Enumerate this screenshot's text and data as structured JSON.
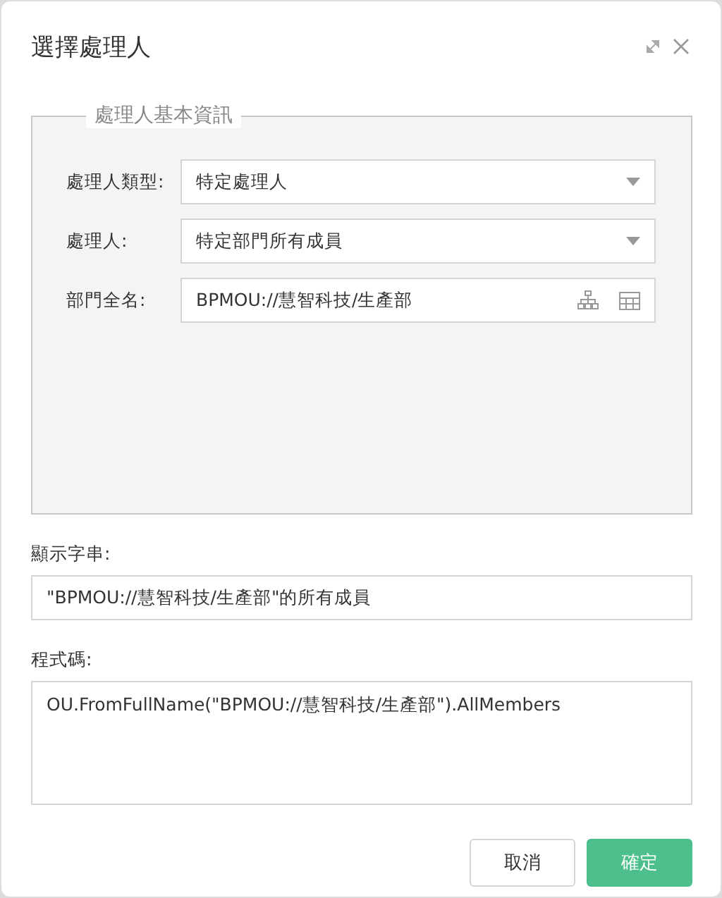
{
  "window": {
    "title": "選擇處理人"
  },
  "basic_info": {
    "legend": "處理人基本資訊",
    "rows": [
      {
        "kind": "select",
        "label": "處理人類型:",
        "value": "特定處理人"
      },
      {
        "kind": "select",
        "label": "處理人:",
        "value": "特定部門所有成員"
      },
      {
        "kind": "picker",
        "label": "部門全名:",
        "value": "BPMOU://慧智科技/生產部"
      }
    ]
  },
  "display_string": {
    "label": "顯示字串:",
    "value": "\"BPMOU://慧智科技/生產部\"的所有成員"
  },
  "code": {
    "label": "程式碼:",
    "value": "OU.FromFullName(\"BPMOU://慧智科技/生產部\").AllMembers"
  },
  "buttons": [
    {
      "kind": "secondary",
      "label": "取消"
    },
    {
      "kind": "primary",
      "label": "確定"
    }
  ]
}
